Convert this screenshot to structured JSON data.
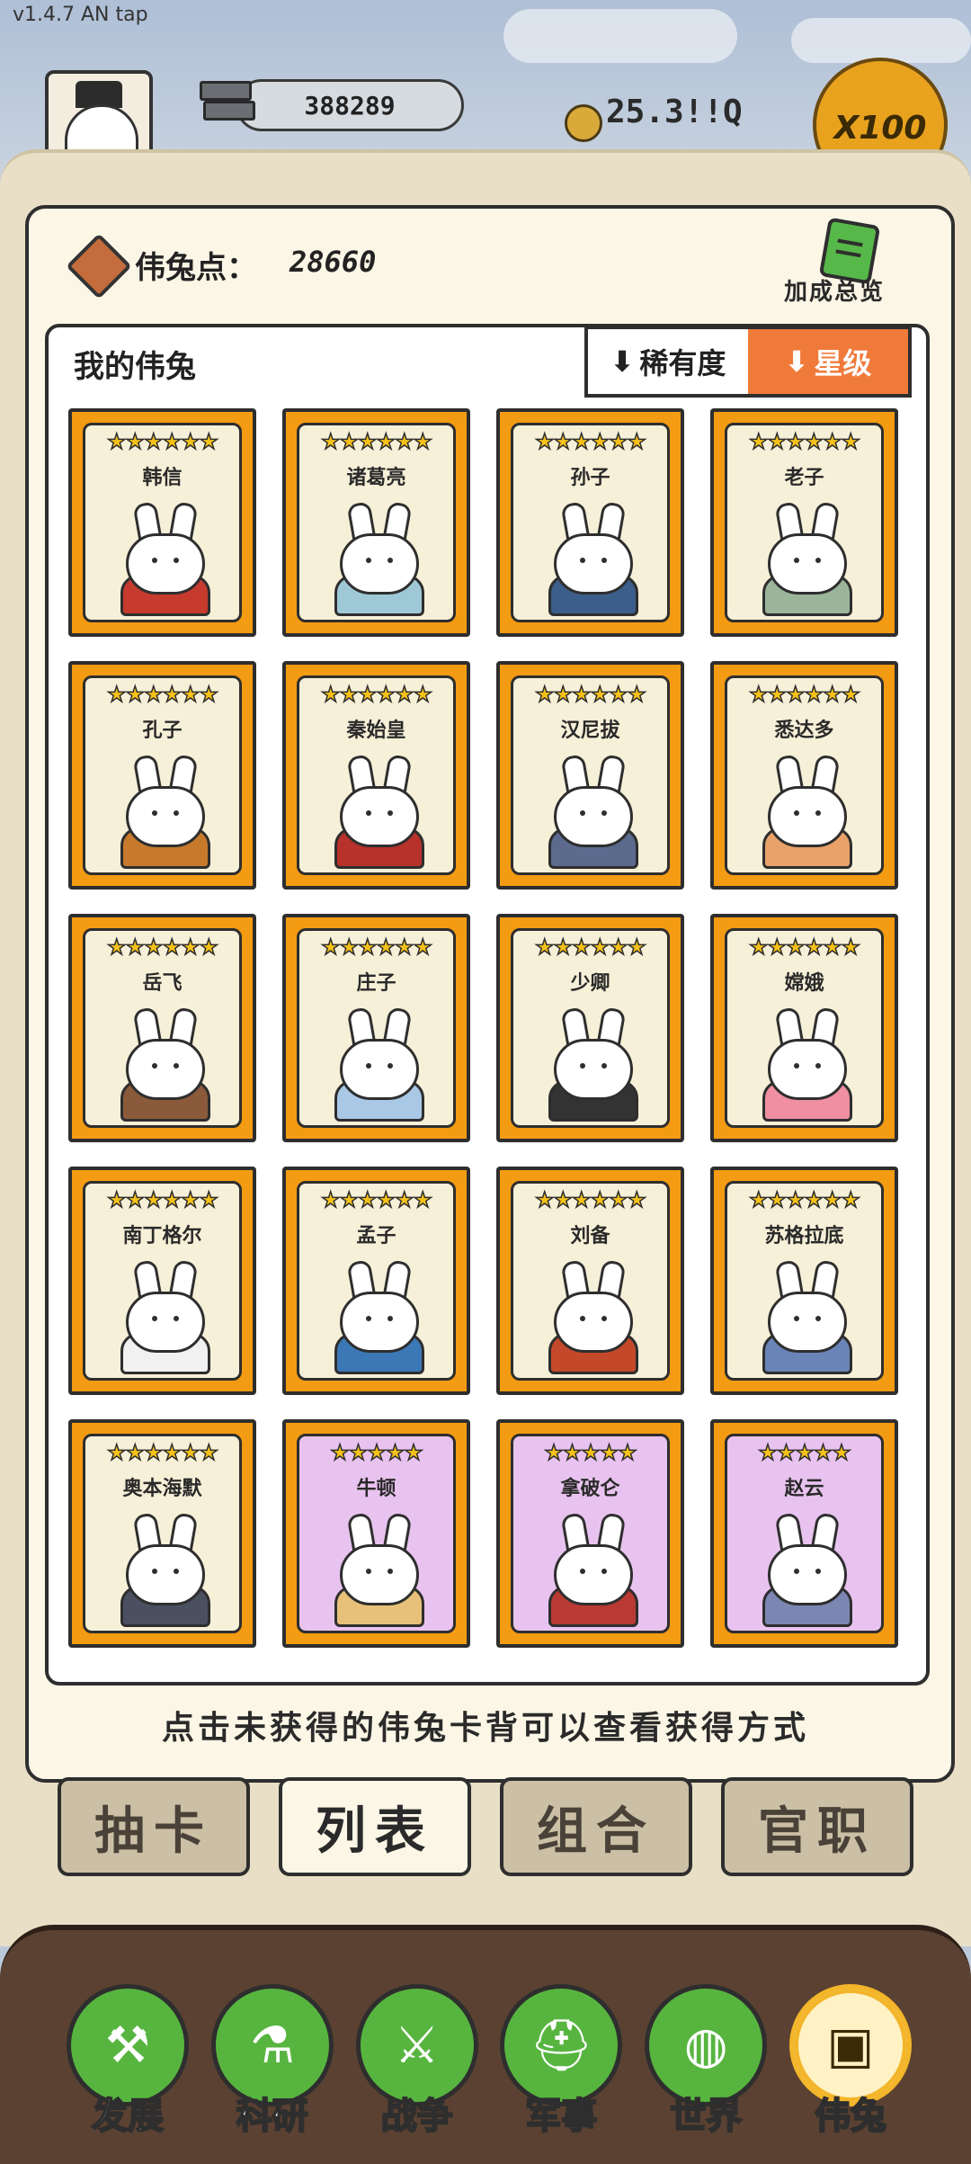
{
  "version": "v1.4.7 AN tap",
  "hud": {
    "resource_value": "388289",
    "gold_value": "25.3!!Q",
    "x100_label": "X100"
  },
  "points": {
    "label": "伟兔点：",
    "value": "28660"
  },
  "bonus_label": "加成总览",
  "list": {
    "title": "我的伟兔",
    "sort_rarity": "稀有度",
    "sort_star": "星级"
  },
  "cards": [
    {
      "name": "韩信",
      "stars": "★★★★★★",
      "purple": false,
      "body": "#c63b2e"
    },
    {
      "name": "诸葛亮",
      "stars": "★★★★★★",
      "purple": false,
      "body": "#9fc8d6"
    },
    {
      "name": "孙子",
      "stars": "★★★★★★",
      "purple": false,
      "body": "#3c5e8a"
    },
    {
      "name": "老子",
      "stars": "★★★★★★",
      "purple": false,
      "body": "#9bb59a"
    },
    {
      "name": "孔子",
      "stars": "★★★★★★",
      "purple": false,
      "body": "#c77a2c"
    },
    {
      "name": "秦始皇",
      "stars": "★★★★★★",
      "purple": false,
      "body": "#b6322a"
    },
    {
      "name": "汉尼拔",
      "stars": "★★★★★★",
      "purple": false,
      "body": "#5c6a8e"
    },
    {
      "name": "悉达多",
      "stars": "★★★★★★",
      "purple": false,
      "body": "#e8a26a"
    },
    {
      "name": "岳飞",
      "stars": "★★★★★★",
      "purple": false,
      "body": "#8a5a3a"
    },
    {
      "name": "庄子",
      "stars": "★★★★★★",
      "purple": false,
      "body": "#a8c8e6"
    },
    {
      "name": "少卿",
      "stars": "★★★★★★",
      "purple": false,
      "body": "#333333"
    },
    {
      "name": "嫦娥",
      "stars": "★★★★★★",
      "purple": false,
      "body": "#ef8fa1"
    },
    {
      "name": "南丁格尔",
      "stars": "★★★★★★",
      "purple": false,
      "body": "#f1f1f1"
    },
    {
      "name": "孟子",
      "stars": "★★★★★★",
      "purple": false,
      "body": "#3d78b6"
    },
    {
      "name": "刘备",
      "stars": "★★★★★★",
      "purple": false,
      "body": "#c4492a"
    },
    {
      "name": "苏格拉底",
      "stars": "★★★★★★",
      "purple": false,
      "body": "#6b84b8"
    },
    {
      "name": "奥本海默",
      "stars": "★★★★★★",
      "purple": false,
      "body": "#4a5060"
    },
    {
      "name": "牛顿",
      "stars": "★★★★★",
      "purple": true,
      "body": "#e7c17a"
    },
    {
      "name": "拿破仑",
      "stars": "★★★★★",
      "purple": true,
      "body": "#b93a32"
    },
    {
      "name": "赵云",
      "stars": "★★★★★",
      "purple": true,
      "body": "#7b86b2"
    }
  ],
  "hint": "点击未获得的伟兔卡背可以查看获得方式",
  "tabs": [
    "抽卡",
    "列表",
    "组合",
    "官职"
  ],
  "active_tab": 1,
  "nav": [
    {
      "label": "发展",
      "icon": "axe-icon",
      "glyph": "⚒"
    },
    {
      "label": "科研",
      "icon": "flask-icon",
      "glyph": "⚗"
    },
    {
      "label": "战争",
      "icon": "crossed-swords-icon",
      "glyph": "⚔"
    },
    {
      "label": "军事",
      "icon": "helmet-icon",
      "glyph": "⛑"
    },
    {
      "label": "世界",
      "icon": "globe-icon",
      "glyph": "◍"
    },
    {
      "label": "伟兔",
      "icon": "card-icon",
      "glyph": "▣"
    }
  ],
  "active_nav": 5
}
